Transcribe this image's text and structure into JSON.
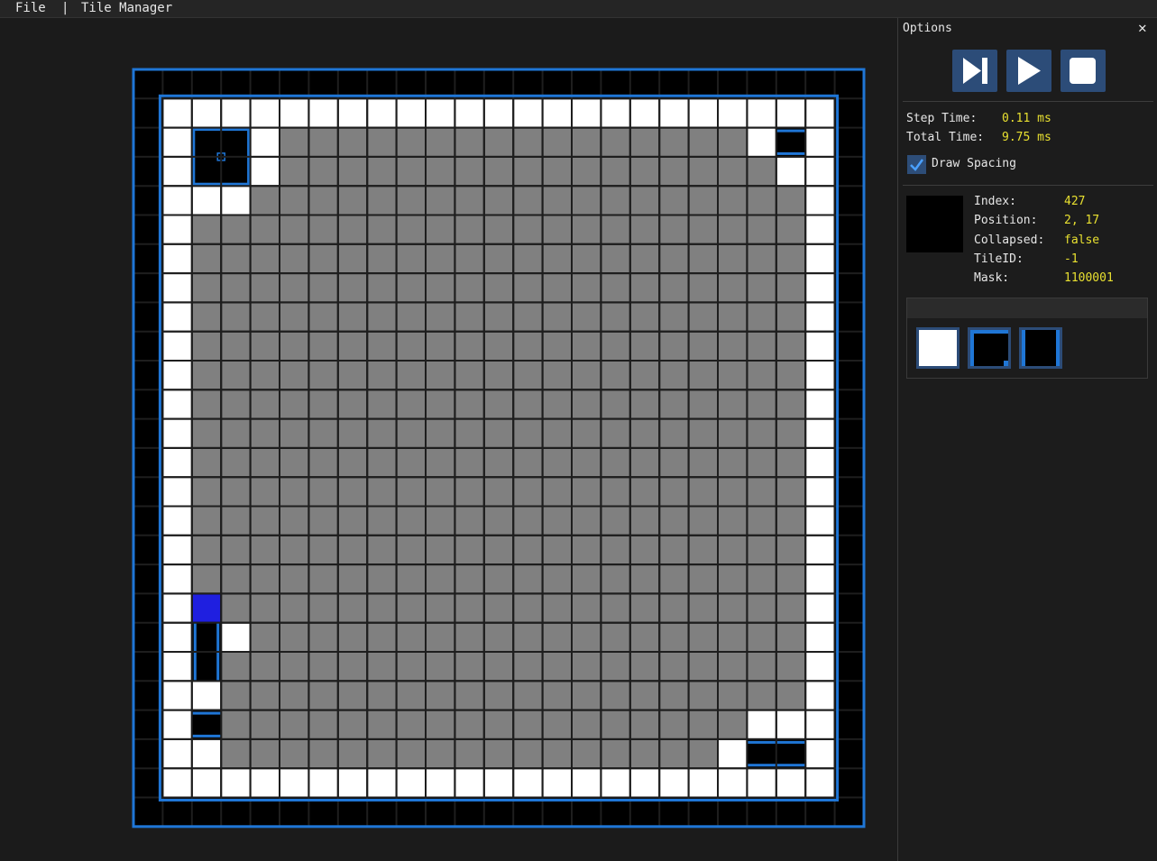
{
  "menubar": {
    "file_label": "File",
    "separator": "|",
    "tile_manager_label": "Tile Manager"
  },
  "grid": {
    "rows": 25,
    "cols": 25,
    "colors": {
      "background": "#1b1b1b",
      "boundary": "#000000",
      "open": "#ffffff",
      "uncollapsed": "#808080",
      "selected": "#1f1fe0",
      "accent": "#1f76d6",
      "grid_line": "#1e1e1e"
    },
    "cells": [
      "BBBBBBBBBBBBBBBBBBBBBBBBB",
      "BWWWWWWWWWWWWWWWWWWWWWWWB",
      "BWHHWGGGGGGGGGGGGGGGGWSWB",
      "BWHHWGGGGGGGGGGGGGGGGGWWB",
      "BWWWGGGGGGGGGGGGGGGGGGGWB",
      "BWGGGGGGGGGGGGGGGGGGGGGWB",
      "BWGGGGGGGGGGGGGGGGGGGGGWB",
      "BWGGGGGGGGGGGGGGGGGGGGGWB",
      "BWGGGGGGGGGGGGGGGGGGGGGWB",
      "BWGGGGGGGGGGGGGGGGGGGGGWB",
      "BWGGGGGGGGGGGGGGGGGGGGGWB",
      "BWGGGGGGGGGGGGGGGGGGGGGWB",
      "BWGGGGGGGGGGGGGGGGGGGGGWB",
      "BWGGGGGGGGGGGGGGGGGGGGGWB",
      "BWGGGGGGGGGGGGGGGGGGGGGWB",
      "BWGGGGGGGGGGGGGGGGGGGGGWB",
      "BWGGGGGGGGGGGGGGGGGGGGGWB",
      "BWGGGGGGGGGGGGGGGGGGGGGWB",
      "BWXGGGGGGGGGGGGGGGGGGGGWB",
      "BWVWGGGGGGGGGGGGGGGGGGGWB",
      "BWVGGGGGGGGGGGGGGGGGGGGWB",
      "BWWGGGGGGGGGGGGGGGGGGGGWB",
      "BWSGGGGGGGGGGGGGGGGGGWWWB",
      "BWWGGGGGGGGGGGGGGGGGWSSWB",
      "BWWWWWWWWWWWWWWWWWWWWWWWB",
      "BBBBBBBBBBBBBBBBBBBBBBBBB"
    ]
  },
  "panel": {
    "title": "Options",
    "close_icon": "close-icon",
    "controls": [
      "step-icon",
      "play-icon",
      "stop-icon"
    ],
    "accent": "#2c4c78",
    "step_time_label": "Step Time:",
    "step_time_value": "0.11 ms",
    "total_time_label": "Total Time:",
    "total_time_value": "9.75 ms",
    "draw_spacing_label": "Draw Spacing",
    "draw_spacing_checked": true,
    "info": {
      "index_label": "Index:",
      "index_value": "427",
      "position_label": "Position:",
      "position_value": "2, 17",
      "collapsed_label": "Collapsed:",
      "collapsed_value": "false",
      "tileid_label": "TileID:",
      "tileid_value": "-1",
      "mask_label": "Mask:",
      "mask_value": "1100001"
    },
    "tile_options": [
      "tile-white-icon",
      "tile-corner-icon",
      "tile-vertical-icon"
    ]
  }
}
